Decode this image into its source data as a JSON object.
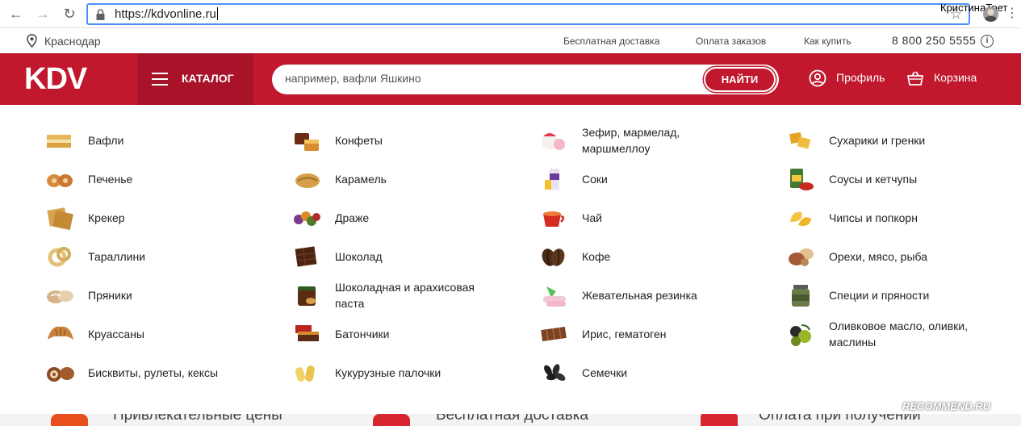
{
  "browser": {
    "url": "https://kdvonline.ru",
    "user_name": "КристинаТрет"
  },
  "infobar": {
    "city": "Краснодар",
    "links": [
      "Бесплатная доставка",
      "Оплата заказов",
      "Как купить"
    ],
    "phone": "8 800 250 5555"
  },
  "header": {
    "logo": "KDV",
    "catalog_label": "КАТАЛОГ",
    "search_placeholder": "например, вафли Яшкино",
    "search_button": "НАЙТИ",
    "profile_label": "Профиль",
    "cart_label": "Корзина"
  },
  "catalog": {
    "columns": [
      [
        {
          "label": "Вафли",
          "icon": "wafer-icon"
        },
        {
          "label": "Печенье",
          "icon": "cookie-icon"
        },
        {
          "label": "Крекер",
          "icon": "cracker-icon"
        },
        {
          "label": "Тараллини",
          "icon": "tarallini-icon"
        },
        {
          "label": "Пряники",
          "icon": "gingerbread-icon"
        },
        {
          "label": "Круассаны",
          "icon": "croissant-icon"
        },
        {
          "label": "Бисквиты, рулеты, кексы",
          "icon": "roll-cake-icon"
        }
      ],
      [
        {
          "label": "Конфеты",
          "icon": "candy-icon"
        },
        {
          "label": "Карамель",
          "icon": "caramel-icon"
        },
        {
          "label": "Драже",
          "icon": "dragee-icon"
        },
        {
          "label": "Шоколад",
          "icon": "chocolate-icon"
        },
        {
          "label": "Шоколадная и арахисовая паста",
          "icon": "chocolate-paste-icon"
        },
        {
          "label": "Батончики",
          "icon": "bar-icon"
        },
        {
          "label": "Кукурузные палочки",
          "icon": "corn-sticks-icon"
        }
      ],
      [
        {
          "label": "Зефир, мармелад, маршмеллоу",
          "icon": "marshmallow-icon"
        },
        {
          "label": "Соки",
          "icon": "juice-icon"
        },
        {
          "label": "Чай",
          "icon": "tea-icon"
        },
        {
          "label": "Кофе",
          "icon": "coffee-icon"
        },
        {
          "label": "Жевательная резинка",
          "icon": "chewing-gum-icon"
        },
        {
          "label": "Ирис, гематоген",
          "icon": "toffee-icon"
        },
        {
          "label": "Семечки",
          "icon": "seeds-icon"
        }
      ],
      [
        {
          "label": "Сухарики и гренки",
          "icon": "croutons-icon"
        },
        {
          "label": "Соусы и кетчупы",
          "icon": "sauce-icon"
        },
        {
          "label": "Чипсы и попкорн",
          "icon": "chips-icon"
        },
        {
          "label": "Орехи, мясо, рыба",
          "icon": "nuts-meat-fish-icon"
        },
        {
          "label": "Специи и пряности",
          "icon": "spices-icon"
        },
        {
          "label": "Оливковое масло, оливки, маслины",
          "icon": "olives-icon"
        }
      ]
    ]
  },
  "bottom_strip": {
    "items": [
      "Привлекательные цены",
      "Бесплатная доставка",
      "Оплата при получении"
    ]
  },
  "watermark": "RECOMMEND.RU",
  "colors": {
    "brand_red": "#c1182e",
    "catalog_dark_red": "#a8132a",
    "address_focus_blue": "#4d90fe"
  }
}
